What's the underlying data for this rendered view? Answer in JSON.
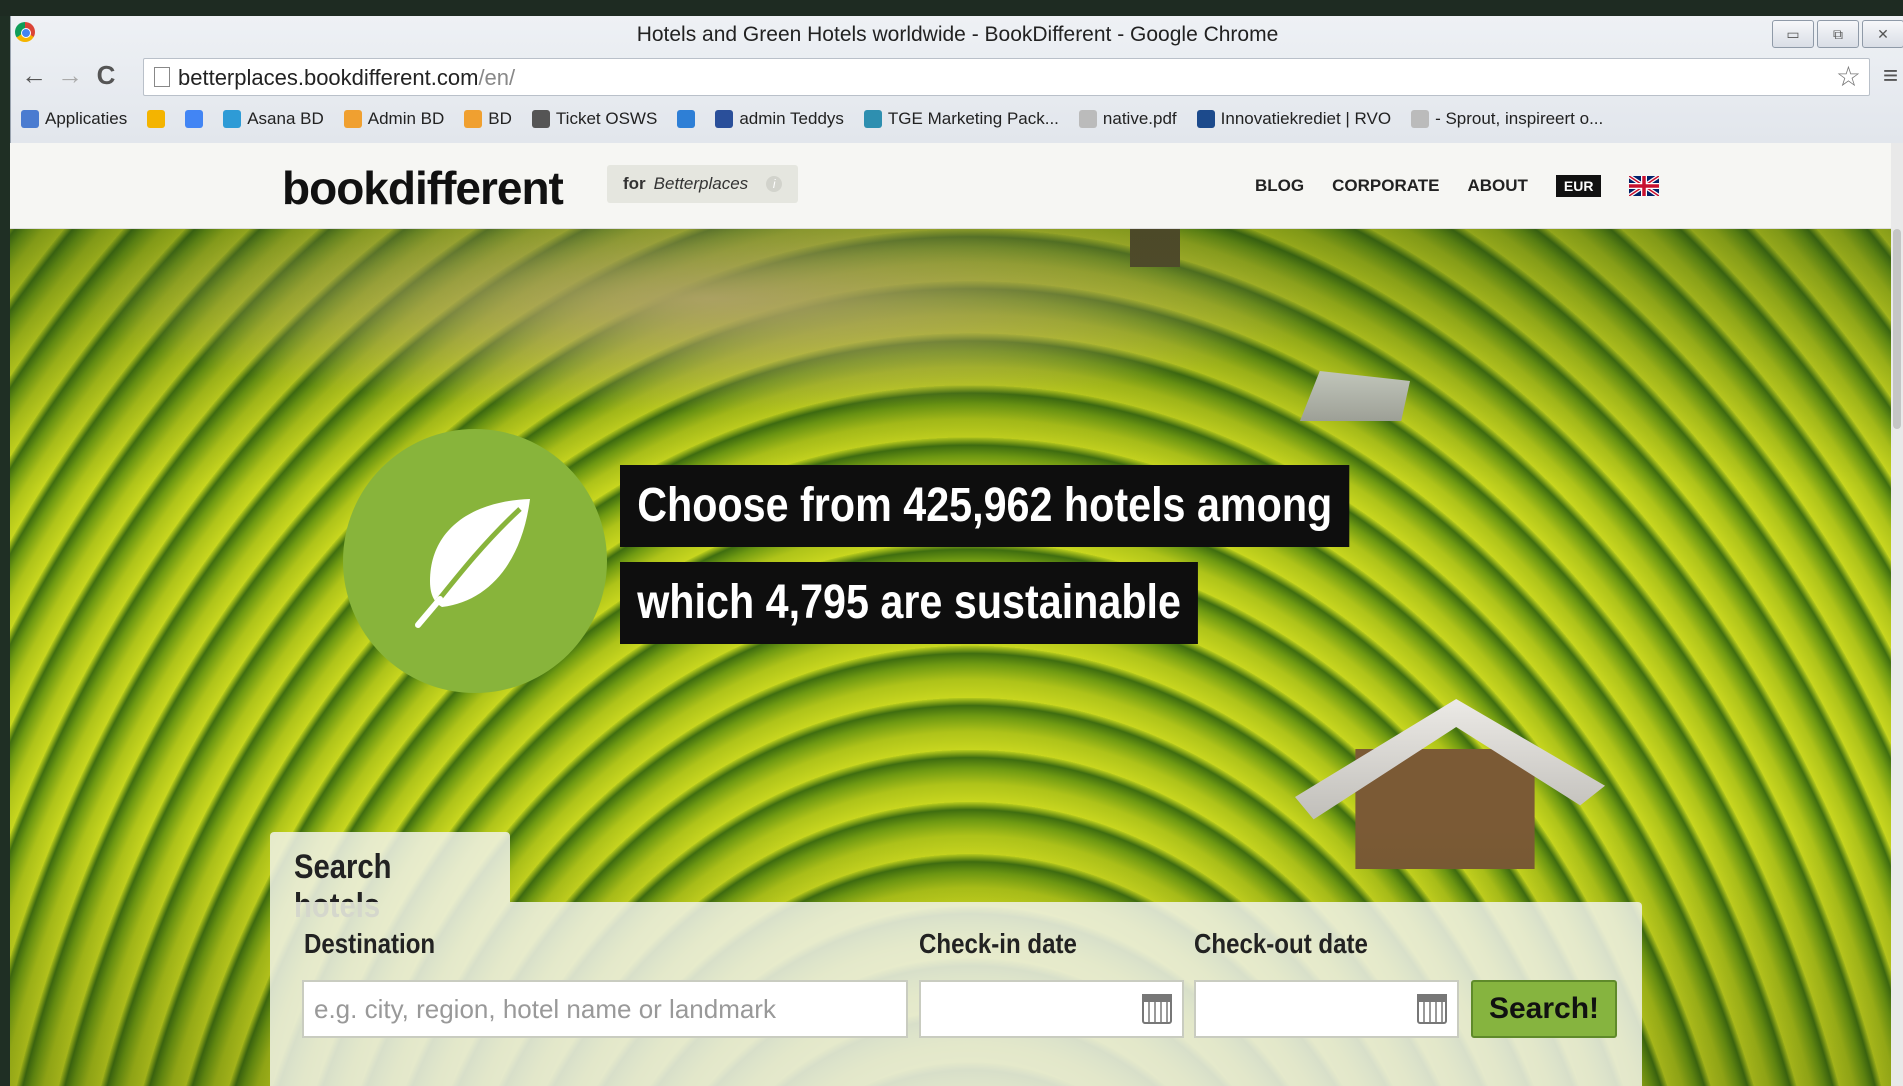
{
  "browser": {
    "window_title": "Hotels and Green Hotels worldwide - BookDifferent - Google Chrome",
    "url_host": "betterplaces.bookdifferent.com",
    "url_path": "/en/",
    "bookmarks": [
      {
        "label": "Applicaties",
        "icon": "apps-grid-icon",
        "color": "#4a7bd0"
      },
      {
        "label": "",
        "icon": "drive-icon",
        "color": "#f4b400"
      },
      {
        "label": "",
        "icon": "google-icon",
        "color": "#4285f4"
      },
      {
        "label": "Asana BD",
        "icon": "asana-icon",
        "color": "#2e9bd6"
      },
      {
        "label": "Admin BD",
        "icon": "admin-icon",
        "color": "#f0a030"
      },
      {
        "label": "BD",
        "icon": "bd-icon",
        "color": "#f0a030"
      },
      {
        "label": "Ticket OSWS",
        "icon": "ticket-icon",
        "color": "#555555"
      },
      {
        "label": "",
        "icon": "x-icon",
        "color": "#2e7fd6"
      },
      {
        "label": "admin Teddys",
        "icon": "teddys-icon",
        "color": "#2a4f9a"
      },
      {
        "label": "TGE Marketing Pack...",
        "icon": "gear-icon",
        "color": "#2e8fb0"
      },
      {
        "label": "native.pdf",
        "icon": "document-icon",
        "color": "#bbbbbb"
      },
      {
        "label": "Innovatiekrediet | RVO",
        "icon": "rvo-icon",
        "color": "#1c4a8c"
      },
      {
        "label": "- Sprout, inspireert o...",
        "icon": "document-icon",
        "color": "#bbbbbb"
      }
    ]
  },
  "site": {
    "logo": "bookdifferent",
    "for_badge": {
      "prefix": "for",
      "partner": "Betterplaces",
      "info": "i"
    },
    "nav": [
      "BLOG",
      "CORPORATE",
      "ABOUT"
    ],
    "currency": "EUR",
    "language_flag": "uk-flag-icon"
  },
  "hero": {
    "headline_line1": "Choose from 425,962 hotels among",
    "headline_line2": "which 4,795 are sustainable"
  },
  "search": {
    "tab_title": "Search hotels",
    "destination_label": "Destination",
    "destination_placeholder": "e.g. city, region, hotel name or landmark",
    "checkin_label": "Check-in date",
    "checkout_label": "Check-out date",
    "button_label": "Search!"
  },
  "colors": {
    "brand_green": "#86b43f",
    "headline_bg": "#0e0e0e"
  }
}
